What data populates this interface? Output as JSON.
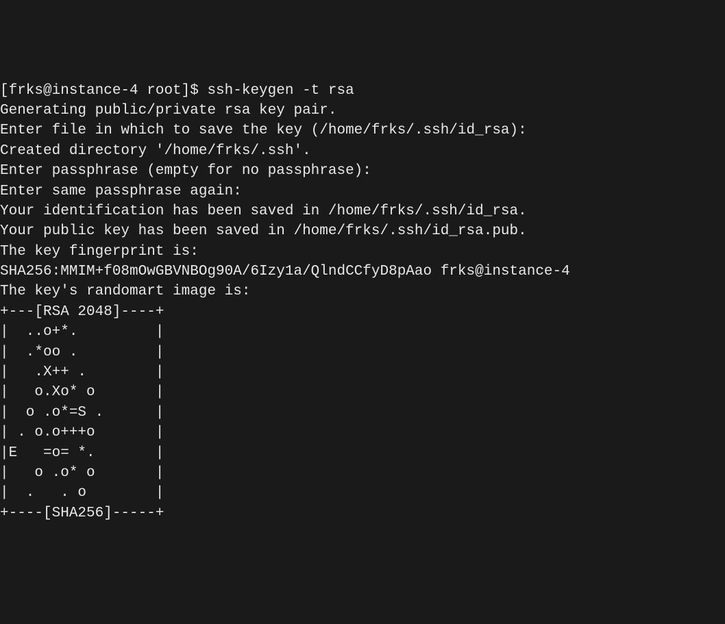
{
  "terminal": {
    "lines": [
      "[frks@instance-4 root]$ ssh-keygen -t rsa",
      "Generating public/private rsa key pair.",
      "Enter file in which to save the key (/home/frks/.ssh/id_rsa):",
      "Created directory '/home/frks/.ssh'.",
      "Enter passphrase (empty for no passphrase):",
      "Enter same passphrase again:",
      "Your identification has been saved in /home/frks/.ssh/id_rsa.",
      "Your public key has been saved in /home/frks/.ssh/id_rsa.pub.",
      "The key fingerprint is:",
      "SHA256:MMIM+f08mOwGBVNBOg90A/6Izy1a/QlndCCfyD8pAao frks@instance-4",
      "The key's randomart image is:",
      "+---[RSA 2048]----+",
      "|  ..o+*.         |",
      "|  .*oo .         |",
      "|   .X++ .        |",
      "|   o.Xo* o       |",
      "|  o .o*=S .      |",
      "| . o.o+++o       |",
      "|E   =o= *.       |",
      "|   o .o* o       |",
      "|  .   . o        |",
      "+----[SHA256]-----+"
    ]
  }
}
